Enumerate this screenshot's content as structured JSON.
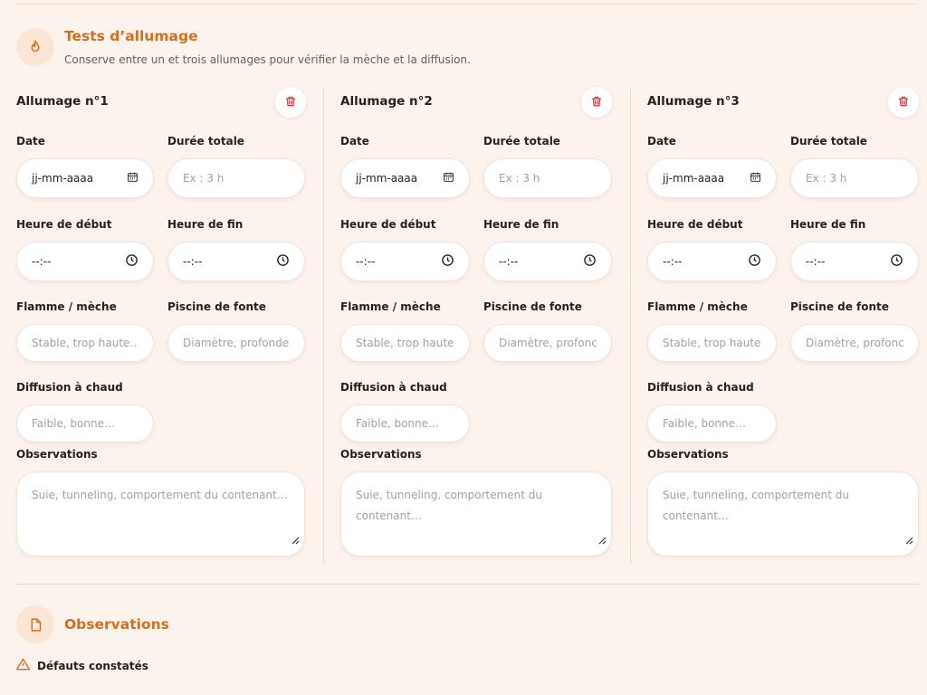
{
  "section_tests": {
    "title": "Tests d’allumage",
    "subtitle": "Conserve entre un et trois allumages pour vérifier la mèche et la diffusion.",
    "icon": "flame-icon"
  },
  "labels": {
    "date": "Date",
    "duration": "Durée totale",
    "start": "Heure de début",
    "end": "Heure de fin",
    "flame": "Flamme / mèche",
    "pool": "Piscine de fonte",
    "diffusion": "Diffusion à chaud",
    "observations": "Observations"
  },
  "trials": [
    {
      "title": "Allumage n°1",
      "date_value": "jj-mm-aaaa",
      "duration_placeholder": "Ex : 3 h",
      "start_value": "--:--",
      "end_value": "--:--",
      "flame_placeholder": "Stable, trop haute…",
      "pool_placeholder": "Diamètre, profonde",
      "diffusion_placeholder": "Faible, bonne…",
      "observations_placeholder": "Suie, tunneling, comportement du contenant…"
    },
    {
      "title": "Allumage n°2",
      "date_value": "jj-mm-aaaa",
      "duration_placeholder": "Ex : 3 h",
      "start_value": "--:--",
      "end_value": "--:--",
      "flame_placeholder": "Stable, trop haute",
      "pool_placeholder": "Diamètre, profonc",
      "diffusion_placeholder": "Faible, bonne…",
      "observations_placeholder": "Suie, tunneling, comportement du contenant…"
    },
    {
      "title": "Allumage n°3",
      "date_value": "jj-mm-aaaa",
      "duration_placeholder": "Ex : 3 h",
      "start_value": "--:--",
      "end_value": "--:--",
      "flame_placeholder": "Stable, trop haute",
      "pool_placeholder": "Diamètre, profonc",
      "diffusion_placeholder": "Faible, bonne…",
      "observations_placeholder": "Suie, tunneling, comportement du contenant…"
    }
  ],
  "section_observations": {
    "title": "Observations",
    "icon": "document-icon"
  },
  "defects": {
    "label": "Défauts constatés",
    "icon": "warning-icon"
  },
  "colors": {
    "accent": "#d26f22",
    "background": "#fdf3ed",
    "delete_icon": "#d9363e"
  }
}
